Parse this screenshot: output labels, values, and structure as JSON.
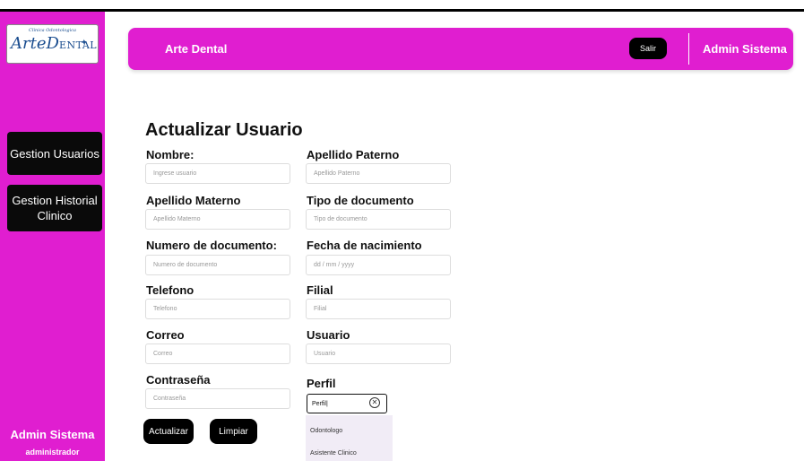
{
  "sidebar": {
    "logo": {
      "tagline": "Clinica Odontologica",
      "name_arte": "Arte",
      "name_d": "D",
      "name_rest": "ENTAL"
    },
    "items": [
      {
        "label": "Gestion Usuarios"
      },
      {
        "label": "Gestion Historial Clinico"
      }
    ],
    "user_name": "Admin Sistema",
    "user_role": "administrador"
  },
  "header": {
    "brand": "Arte Dental",
    "logout_label": "Salir",
    "user_name": "Admin Sistema"
  },
  "form": {
    "title": "Actualizar Usuario",
    "fields": {
      "nombre": {
        "label": "Nombre:",
        "placeholder": "Ingrese usuario"
      },
      "apellido_paterno": {
        "label": "Apellido Paterno",
        "placeholder": "Apellido Paterno"
      },
      "apellido_materno": {
        "label": "Apellido Materno",
        "placeholder": "Apellido Materno"
      },
      "tipo_documento": {
        "label": "Tipo de documento",
        "placeholder": "Tipo de documento"
      },
      "numero_documento": {
        "label": "Numero de documento:",
        "placeholder": "Numero de documento"
      },
      "fecha_nacimiento": {
        "label": "Fecha de nacimiento",
        "placeholder": "dd / mm / yyyy"
      },
      "telefono": {
        "label": "Telefono",
        "placeholder": "Telefono"
      },
      "filial": {
        "label": "Filial",
        "placeholder": "Filial"
      },
      "correo": {
        "label": "Correo",
        "placeholder": "Correo"
      },
      "usuario": {
        "label": "Usuario",
        "placeholder": "Usuario"
      },
      "contrasena": {
        "label": "Contraseña",
        "placeholder": "Contraseña"
      },
      "perfil": {
        "label": "Perfil",
        "value": "Perfil|"
      }
    },
    "perfil_options": [
      "Odontologo",
      "Asistente Clinico"
    ],
    "update_label": "Actualizar",
    "clear_label": "Limpiar"
  },
  "colors": {
    "accent": "#e01ed0",
    "button": "#000000",
    "dropdown_bg": "#f1ecf6"
  }
}
